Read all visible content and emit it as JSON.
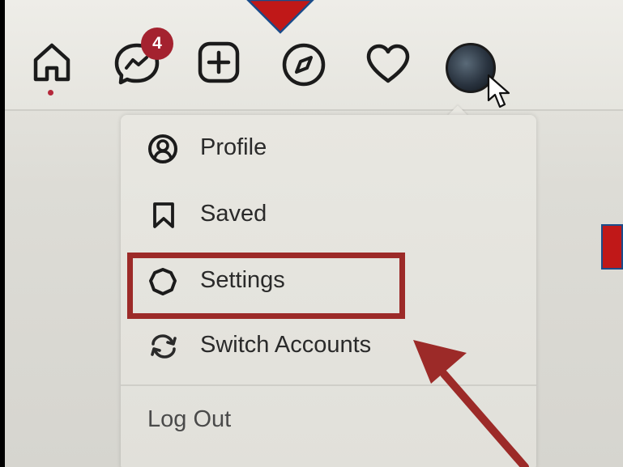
{
  "nav": {
    "icons": [
      "home-icon",
      "messenger-icon",
      "new-post-icon",
      "explore-icon",
      "activity-heart-icon",
      "profile-avatar"
    ],
    "messages_badge": "4"
  },
  "menu": {
    "items": [
      {
        "label": "Profile",
        "icon": "profile-circle-icon"
      },
      {
        "label": "Saved",
        "icon": "bookmark-icon"
      },
      {
        "label": "Settings",
        "icon": "settings-gear-icon"
      },
      {
        "label": "Switch Accounts",
        "icon": "switch-accounts-icon"
      }
    ],
    "logout_label": "Log Out"
  },
  "colors": {
    "badge": "#a4222f",
    "annotation": "#9c2a28",
    "marker": "#c01818"
  }
}
